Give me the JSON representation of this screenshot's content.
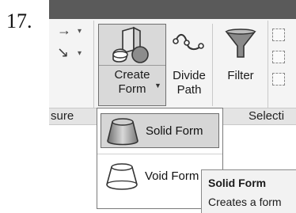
{
  "figure": {
    "step_number": "17."
  },
  "ribbon": {
    "buttons": {
      "create_form": {
        "line1": "Create",
        "line2": "Form"
      },
      "divide_path": {
        "line1": "Divide",
        "line2": "Path"
      },
      "filter": {
        "line1": "Filter"
      }
    },
    "panels": {
      "measure": "sure",
      "selection": "Selecti"
    }
  },
  "menu": {
    "items": [
      {
        "label": "Solid Form",
        "icon": "solid-form-icon",
        "active": true
      },
      {
        "label": "Void Form",
        "icon": "void-form-icon",
        "active": false
      }
    ]
  },
  "tooltip": {
    "title": "Solid Form",
    "description": "Creates a form"
  }
}
